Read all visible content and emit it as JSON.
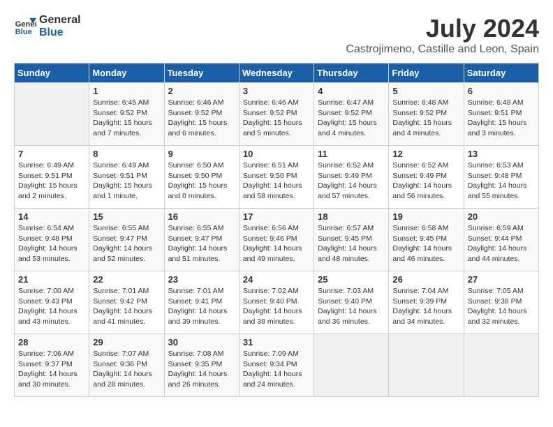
{
  "header": {
    "logo_line1": "General",
    "logo_line2": "Blue",
    "month": "July 2024",
    "location": "Castrojimeno, Castille and Leon, Spain"
  },
  "days_of_week": [
    "Sunday",
    "Monday",
    "Tuesday",
    "Wednesday",
    "Thursday",
    "Friday",
    "Saturday"
  ],
  "weeks": [
    [
      {
        "day": "",
        "info": ""
      },
      {
        "day": "1",
        "info": "Sunrise: 6:45 AM\nSunset: 9:52 PM\nDaylight: 15 hours\nand 7 minutes."
      },
      {
        "day": "2",
        "info": "Sunrise: 6:46 AM\nSunset: 9:52 PM\nDaylight: 15 hours\nand 6 minutes."
      },
      {
        "day": "3",
        "info": "Sunrise: 6:46 AM\nSunset: 9:52 PM\nDaylight: 15 hours\nand 5 minutes."
      },
      {
        "day": "4",
        "info": "Sunrise: 6:47 AM\nSunset: 9:52 PM\nDaylight: 15 hours\nand 4 minutes."
      },
      {
        "day": "5",
        "info": "Sunrise: 6:48 AM\nSunset: 9:52 PM\nDaylight: 15 hours\nand 4 minutes."
      },
      {
        "day": "6",
        "info": "Sunrise: 6:48 AM\nSunset: 9:51 PM\nDaylight: 15 hours\nand 3 minutes."
      }
    ],
    [
      {
        "day": "7",
        "info": "Sunrise: 6:49 AM\nSunset: 9:51 PM\nDaylight: 15 hours\nand 2 minutes."
      },
      {
        "day": "8",
        "info": "Sunrise: 6:49 AM\nSunset: 9:51 PM\nDaylight: 15 hours\nand 1 minute."
      },
      {
        "day": "9",
        "info": "Sunrise: 6:50 AM\nSunset: 9:50 PM\nDaylight: 15 hours\nand 0 minutes."
      },
      {
        "day": "10",
        "info": "Sunrise: 6:51 AM\nSunset: 9:50 PM\nDaylight: 14 hours\nand 58 minutes."
      },
      {
        "day": "11",
        "info": "Sunrise: 6:52 AM\nSunset: 9:49 PM\nDaylight: 14 hours\nand 57 minutes."
      },
      {
        "day": "12",
        "info": "Sunrise: 6:52 AM\nSunset: 9:49 PM\nDaylight: 14 hours\nand 56 minutes."
      },
      {
        "day": "13",
        "info": "Sunrise: 6:53 AM\nSunset: 9:48 PM\nDaylight: 14 hours\nand 55 minutes."
      }
    ],
    [
      {
        "day": "14",
        "info": "Sunrise: 6:54 AM\nSunset: 9:48 PM\nDaylight: 14 hours\nand 53 minutes."
      },
      {
        "day": "15",
        "info": "Sunrise: 6:55 AM\nSunset: 9:47 PM\nDaylight: 14 hours\nand 52 minutes."
      },
      {
        "day": "16",
        "info": "Sunrise: 6:55 AM\nSunset: 9:47 PM\nDaylight: 14 hours\nand 51 minutes."
      },
      {
        "day": "17",
        "info": "Sunrise: 6:56 AM\nSunset: 9:46 PM\nDaylight: 14 hours\nand 49 minutes."
      },
      {
        "day": "18",
        "info": "Sunrise: 6:57 AM\nSunset: 9:45 PM\nDaylight: 14 hours\nand 48 minutes."
      },
      {
        "day": "19",
        "info": "Sunrise: 6:58 AM\nSunset: 9:45 PM\nDaylight: 14 hours\nand 46 minutes."
      },
      {
        "day": "20",
        "info": "Sunrise: 6:59 AM\nSunset: 9:44 PM\nDaylight: 14 hours\nand 44 minutes."
      }
    ],
    [
      {
        "day": "21",
        "info": "Sunrise: 7:00 AM\nSunset: 9:43 PM\nDaylight: 14 hours\nand 43 minutes."
      },
      {
        "day": "22",
        "info": "Sunrise: 7:01 AM\nSunset: 9:42 PM\nDaylight: 14 hours\nand 41 minutes."
      },
      {
        "day": "23",
        "info": "Sunrise: 7:01 AM\nSunset: 9:41 PM\nDaylight: 14 hours\nand 39 minutes."
      },
      {
        "day": "24",
        "info": "Sunrise: 7:02 AM\nSunset: 9:40 PM\nDaylight: 14 hours\nand 38 minutes."
      },
      {
        "day": "25",
        "info": "Sunrise: 7:03 AM\nSunset: 9:40 PM\nDaylight: 14 hours\nand 36 minutes."
      },
      {
        "day": "26",
        "info": "Sunrise: 7:04 AM\nSunset: 9:39 PM\nDaylight: 14 hours\nand 34 minutes."
      },
      {
        "day": "27",
        "info": "Sunrise: 7:05 AM\nSunset: 9:38 PM\nDaylight: 14 hours\nand 32 minutes."
      }
    ],
    [
      {
        "day": "28",
        "info": "Sunrise: 7:06 AM\nSunset: 9:37 PM\nDaylight: 14 hours\nand 30 minutes."
      },
      {
        "day": "29",
        "info": "Sunrise: 7:07 AM\nSunset: 9:36 PM\nDaylight: 14 hours\nand 28 minutes."
      },
      {
        "day": "30",
        "info": "Sunrise: 7:08 AM\nSunset: 9:35 PM\nDaylight: 14 hours\nand 26 minutes."
      },
      {
        "day": "31",
        "info": "Sunrise: 7:09 AM\nSunset: 9:34 PM\nDaylight: 14 hours\nand 24 minutes."
      },
      {
        "day": "",
        "info": ""
      },
      {
        "day": "",
        "info": ""
      },
      {
        "day": "",
        "info": ""
      }
    ]
  ]
}
